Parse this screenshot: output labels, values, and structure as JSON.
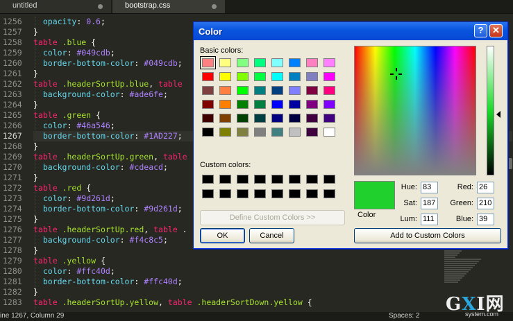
{
  "editor": {
    "tabs": [
      {
        "label": "untitled"
      },
      {
        "label": "bootstrap.css"
      }
    ],
    "line_numbers": [
      "1256",
      "1257",
      "1258",
      "1259",
      "1260",
      "1261",
      "1262",
      "1263",
      "1264",
      "1265",
      "1266",
      "1267",
      "1268",
      "1269",
      "1270",
      "1271",
      "1272",
      "1273",
      "1274",
      "1275",
      "1276",
      "1277",
      "1278",
      "1279",
      "1280",
      "1281",
      "1282",
      "1283"
    ],
    "current_line": "1267",
    "status": {
      "position": "ine 1267, Column 29",
      "spaces": "Spaces: 2"
    },
    "colors": {
      "background": "#272822",
      "keyword": "#f92672",
      "class": "#a6e22e",
      "property": "#66d9ef",
      "value": "#ae81ff"
    }
  },
  "dialog": {
    "title": "Color",
    "help_glyph": "?",
    "close_glyph": "✕",
    "basic_colors_label": "Basic colors:",
    "custom_colors_label": "Custom colors:",
    "define_custom_label": "Define Custom Colors >>",
    "ok_label": "OK",
    "cancel_label": "Cancel",
    "color_label": "Color",
    "add_custom_label": "Add to Custom Colors",
    "fields": {
      "hue_label": "Hue:",
      "hue": "83",
      "sat_label": "Sat:",
      "sat": "187",
      "lum_label": "Lum:",
      "lum": "111",
      "red_label": "Red:",
      "red": "26",
      "green_label": "Green:",
      "green": "210",
      "blue_label": "Blue:",
      "blue": "39"
    },
    "basic_colors": [
      "#ff8080",
      "#ffff80",
      "#80ff80",
      "#00ff80",
      "#80ffff",
      "#0080ff",
      "#ff80c0",
      "#ff80ff",
      "#ff0000",
      "#ffff00",
      "#80ff00",
      "#00ff40",
      "#00ffff",
      "#0080c0",
      "#8080c0",
      "#ff00ff",
      "#804040",
      "#ff8040",
      "#00ff00",
      "#008080",
      "#004080",
      "#8080ff",
      "#800040",
      "#ff0080",
      "#800000",
      "#ff8000",
      "#008000",
      "#008040",
      "#0000ff",
      "#0000a0",
      "#800080",
      "#8000ff",
      "#400000",
      "#804000",
      "#004000",
      "#004040",
      "#000080",
      "#000040",
      "#400040",
      "#400080",
      "#000000",
      "#808000",
      "#808040",
      "#808080",
      "#408080",
      "#c0c0c0",
      "#400040",
      "#ffffff"
    ],
    "selected_color": "#20d12e"
  }
}
